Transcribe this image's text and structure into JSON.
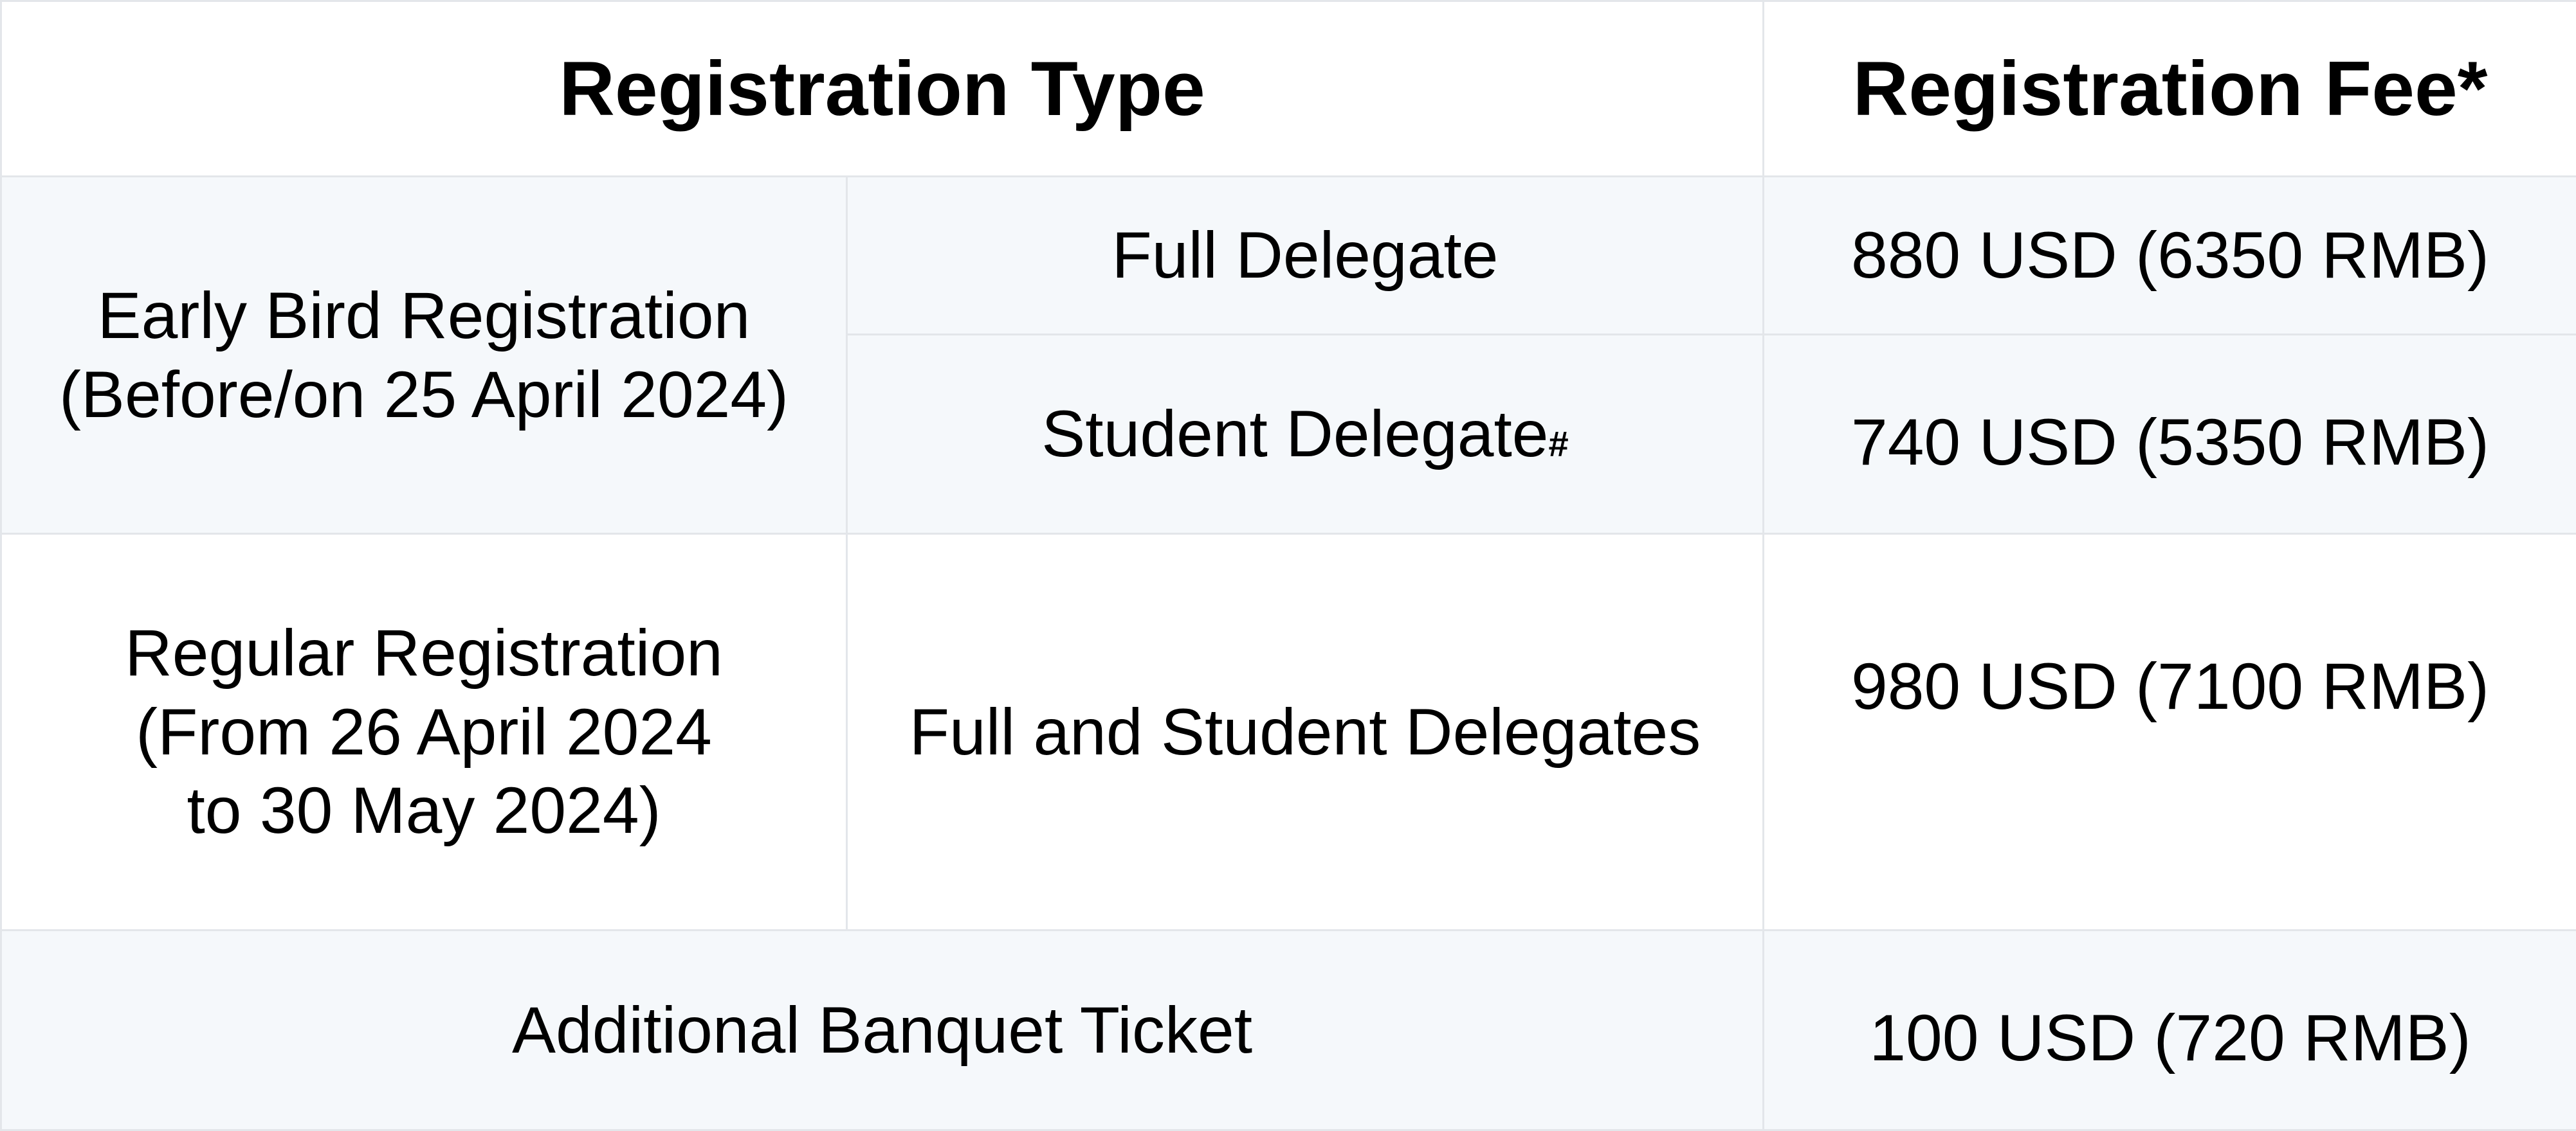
{
  "header": {
    "type_label": "Registration Type",
    "fee_label": "Registration Fee*"
  },
  "early_bird": {
    "period_line1": "Early Bird Registration",
    "period_line2": "(Before/on 25 April 2024)",
    "full_delegate_label": "Full Delegate",
    "full_delegate_fee": "880 USD (6350 RMB)",
    "student_delegate_label": "Student Delegate",
    "student_delegate_mark": "#",
    "student_delegate_fee": "740 USD (5350 RMB)"
  },
  "regular": {
    "period_line1": "Regular Registration",
    "period_line2": "(From 26 April 2024",
    "period_line3": "to 30 May 2024)",
    "delegate_label": "Full and Student Delegates",
    "fee": "980 USD (7100 RMB)"
  },
  "banquet": {
    "label": "Additional Banquet Ticket",
    "fee": "100 USD (720 RMB)"
  }
}
